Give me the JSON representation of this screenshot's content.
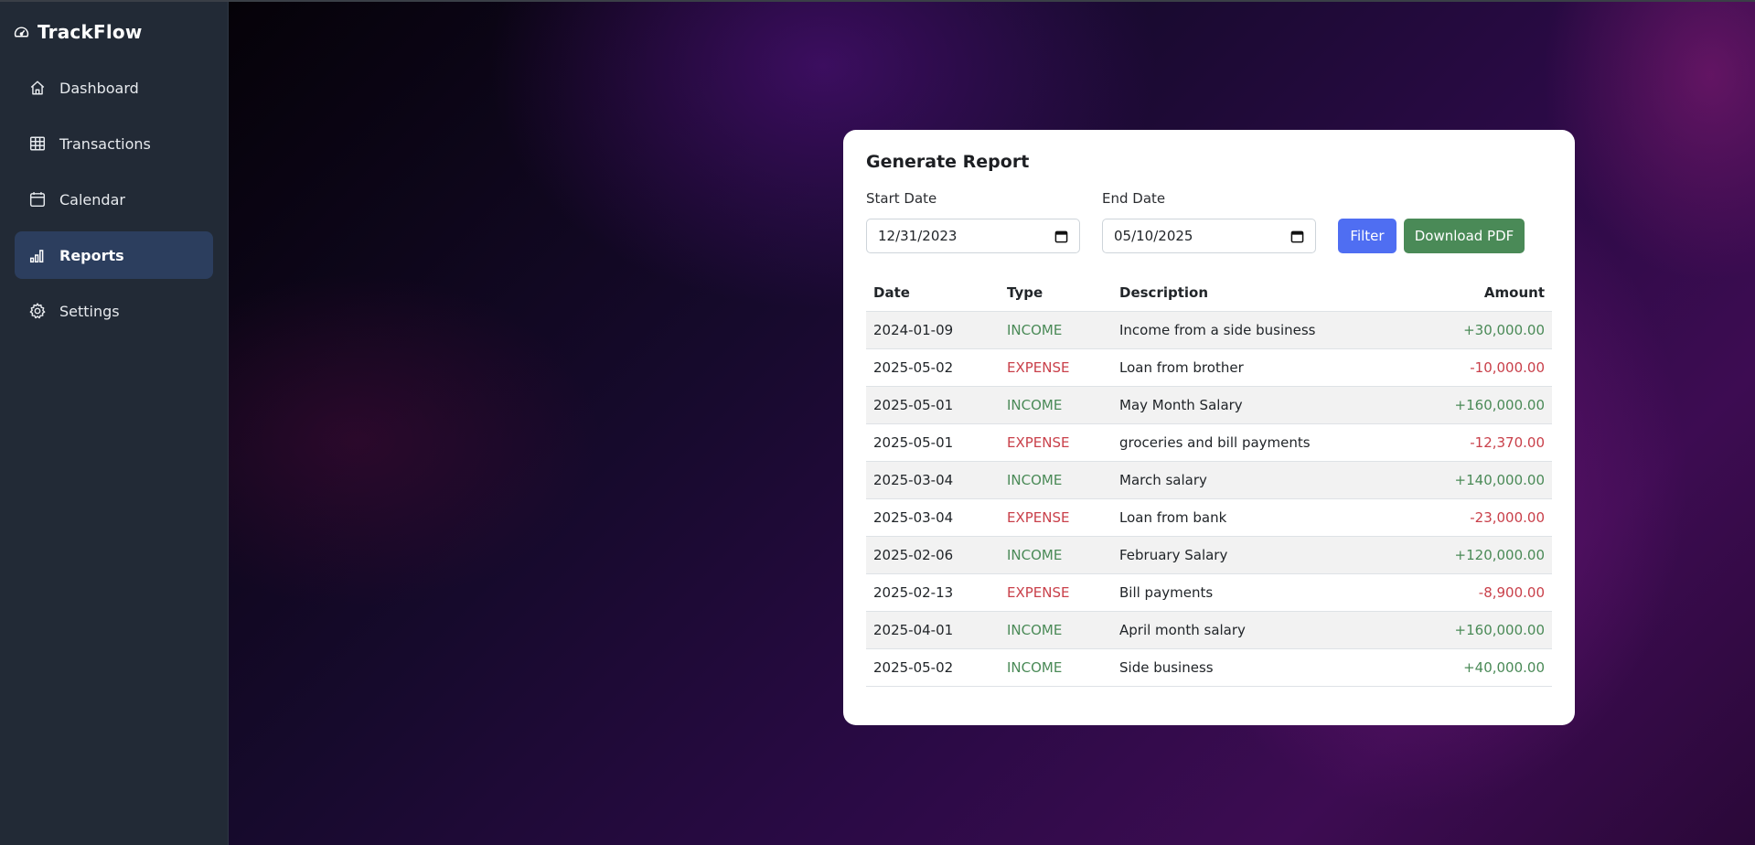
{
  "app": {
    "name": "TrackFlow",
    "logo_icon": "gauge-icon"
  },
  "sidebar": {
    "items": [
      {
        "label": "Dashboard",
        "icon": "home-icon",
        "active": false
      },
      {
        "label": "Transactions",
        "icon": "table-icon",
        "active": false
      },
      {
        "label": "Calendar",
        "icon": "calendar-icon",
        "active": false
      },
      {
        "label": "Reports",
        "icon": "bar-chart-icon",
        "active": true
      },
      {
        "label": "Settings",
        "icon": "gear-icon",
        "active": false
      }
    ]
  },
  "report": {
    "title": "Generate Report",
    "start_label": "Start Date",
    "start_value": "12/31/2023",
    "end_label": "End Date",
    "end_value": "05/10/2025",
    "filter_label": "Filter",
    "download_label": "Download PDF"
  },
  "table": {
    "headers": {
      "date": "Date",
      "type": "Type",
      "description": "Description",
      "amount": "Amount"
    },
    "rows": [
      {
        "date": "2024-01-09",
        "type": "INCOME",
        "description": "Income from a side business",
        "amount": "+30,000.00"
      },
      {
        "date": "2025-05-02",
        "type": "EXPENSE",
        "description": "Loan from brother",
        "amount": "-10,000.00"
      },
      {
        "date": "2025-05-01",
        "type": "INCOME",
        "description": "May Month Salary",
        "amount": "+160,000.00"
      },
      {
        "date": "2025-05-01",
        "type": "EXPENSE",
        "description": "groceries and bill payments",
        "amount": "-12,370.00"
      },
      {
        "date": "2025-03-04",
        "type": "INCOME",
        "description": "March salary",
        "amount": "+140,000.00"
      },
      {
        "date": "2025-03-04",
        "type": "EXPENSE",
        "description": "Loan from bank",
        "amount": "-23,000.00"
      },
      {
        "date": "2025-02-06",
        "type": "INCOME",
        "description": "February Salary",
        "amount": "+120,000.00"
      },
      {
        "date": "2025-02-13",
        "type": "EXPENSE",
        "description": "Bill payments",
        "amount": "-8,900.00"
      },
      {
        "date": "2025-04-01",
        "type": "INCOME",
        "description": "April month salary",
        "amount": "+160,000.00"
      },
      {
        "date": "2025-05-02",
        "type": "INCOME",
        "description": "Side business",
        "amount": "+40,000.00"
      }
    ]
  },
  "colors": {
    "sidebar_bg": "#222a36",
    "active_item_bg": "#2c3e5e",
    "income": "#4a8a57",
    "expense": "#c9404a",
    "filter_button": "#4f6ef2",
    "download_button": "#4a8a57"
  }
}
